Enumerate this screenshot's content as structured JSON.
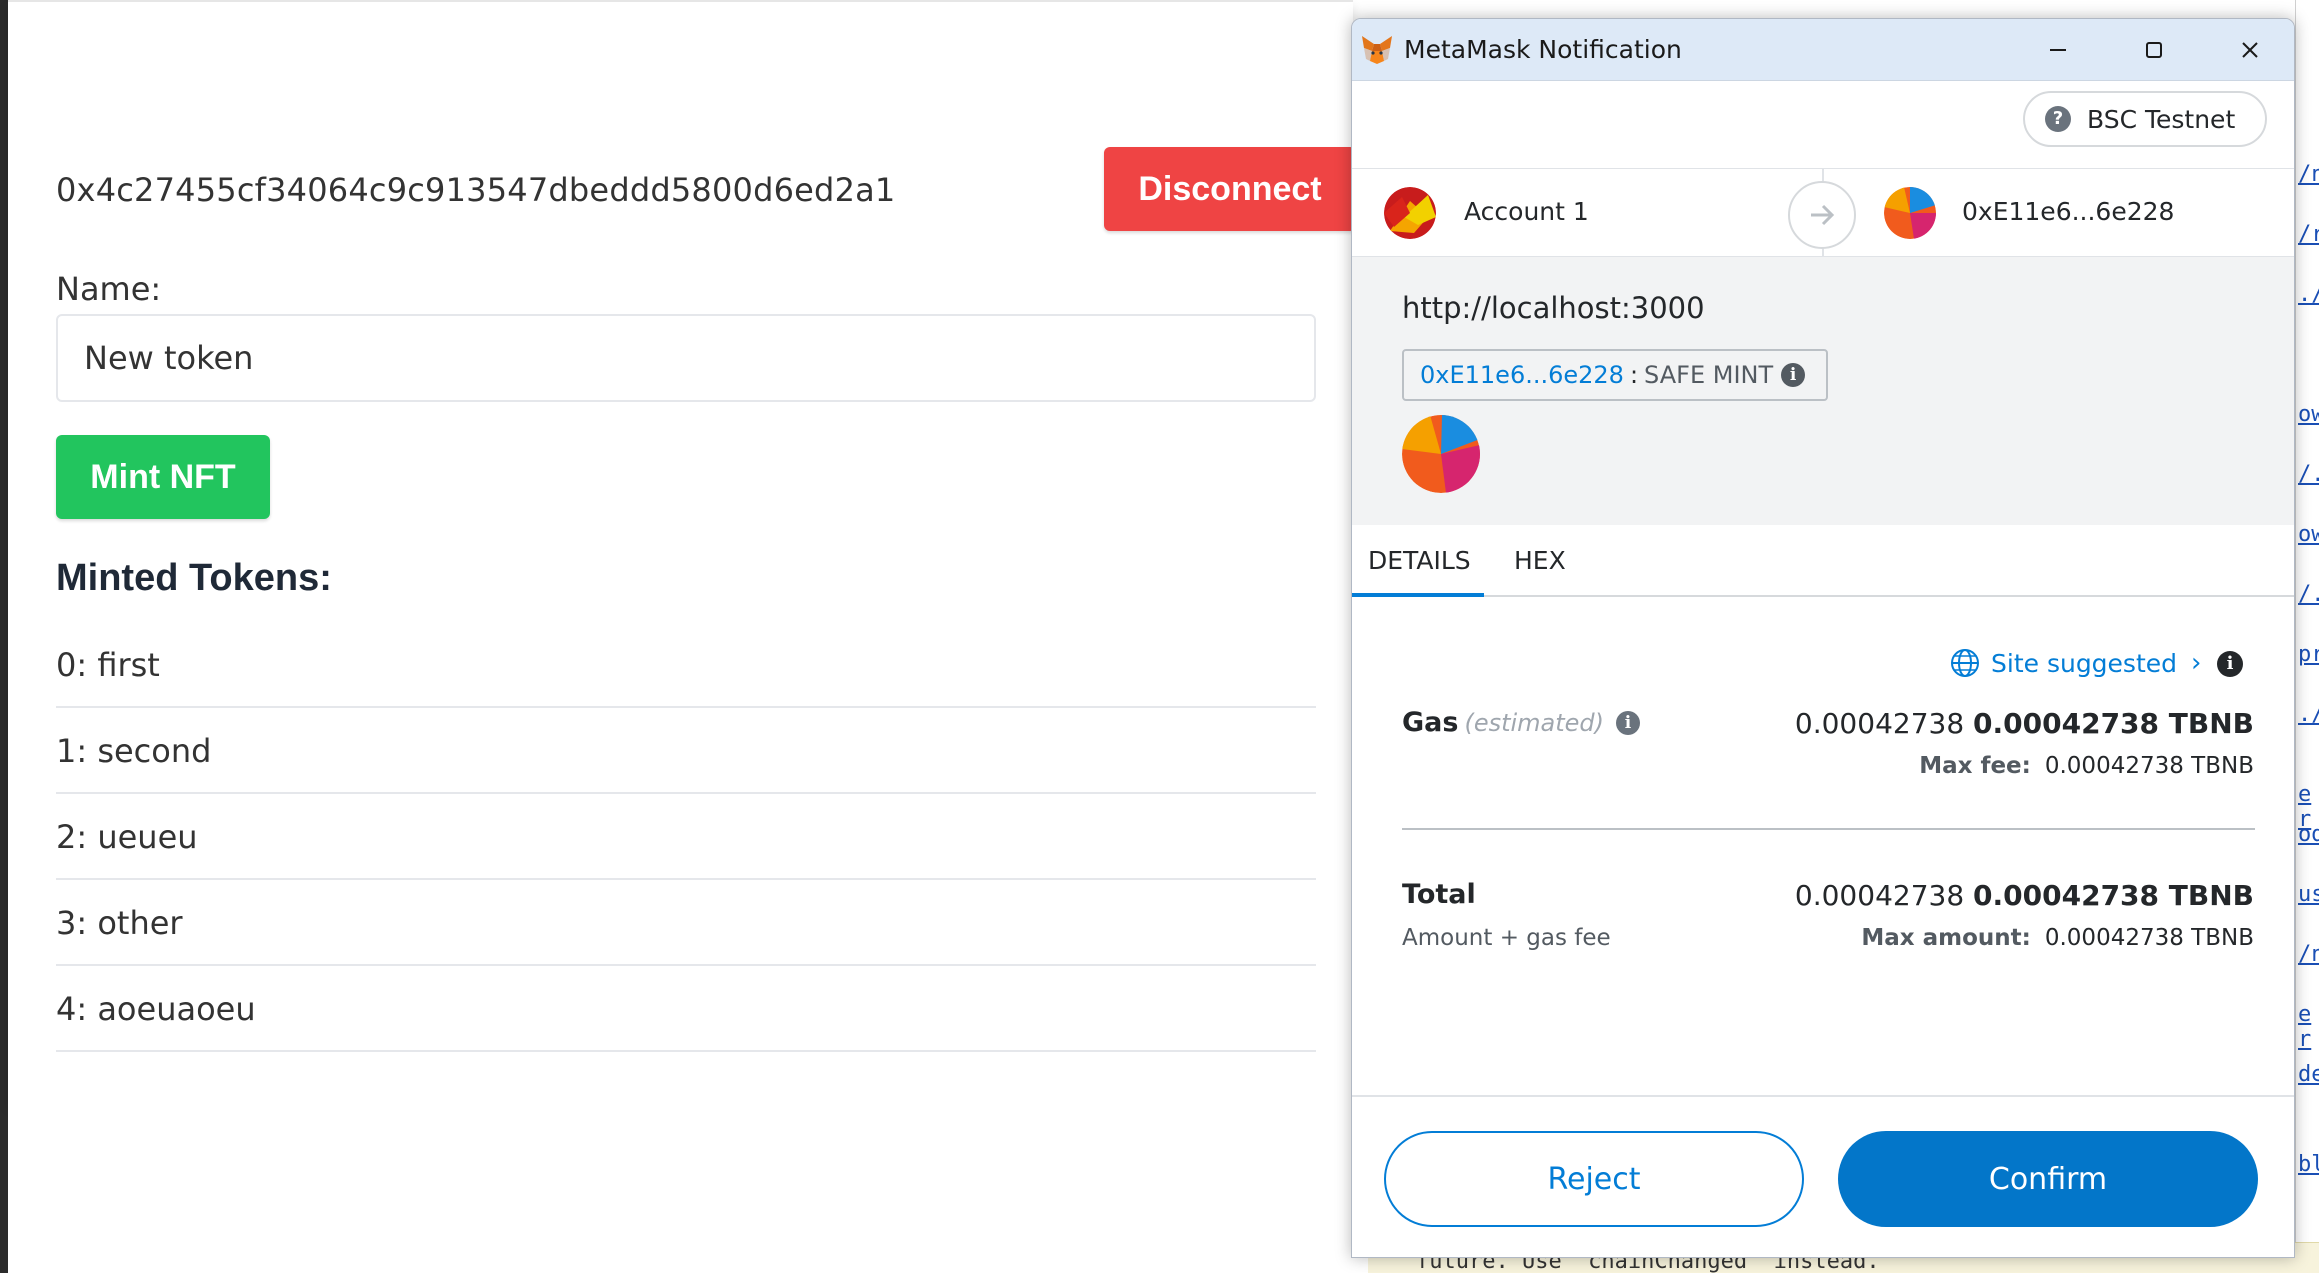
{
  "dapp": {
    "address": "0x4c27455cf34064c9c913547dbeddd5800d6ed2a1",
    "disconnect_label": "Disconnect",
    "name_label": "Name:",
    "name_value": "New token",
    "mint_label": "Mint NFT",
    "minted_title": "Minted Tokens:",
    "tokens": [
      "0: first",
      "1: second",
      "2: ueueu",
      "3: other",
      "4: aoeuaoeu"
    ]
  },
  "metamask": {
    "window_title": "MetaMask Notification",
    "network": "BSC Testnet",
    "from_account": "Account 1",
    "to_account": "0xE11e6...6e228",
    "origin": "http://localhost:3000",
    "contract_address": "0xE11e6...6e228",
    "method_separator": ":",
    "method": "SAFE MINT",
    "tabs": [
      "DETAILS",
      "HEX"
    ],
    "site_suggested": "Site suggested",
    "gas_label": "Gas",
    "gas_estimated": "(estimated)",
    "gas_fiat": "0.00042738",
    "gas_amount": "0.00042738 TBNB",
    "max_fee_label": "Max fee:",
    "max_fee_value": "0.00042738 TBNB",
    "total_label": "Total",
    "total_sub": "Amount + gas fee",
    "total_fiat": "0.00042738",
    "total_amount": "0.00042738 TBNB",
    "max_amount_label": "Max amount:",
    "max_amount_value": "0.00042738 TBNB",
    "reject_label": "Reject",
    "confirm_label": "Confirm",
    "colors": {
      "accent_blue": "#037dd6",
      "confirm_blue": "#0376c9",
      "disconnect_red": "#ef4444",
      "mint_green": "#22c55e"
    }
  },
  "background": {
    "devtools_snippet": "future. Use 'chainChanged' instead."
  }
}
